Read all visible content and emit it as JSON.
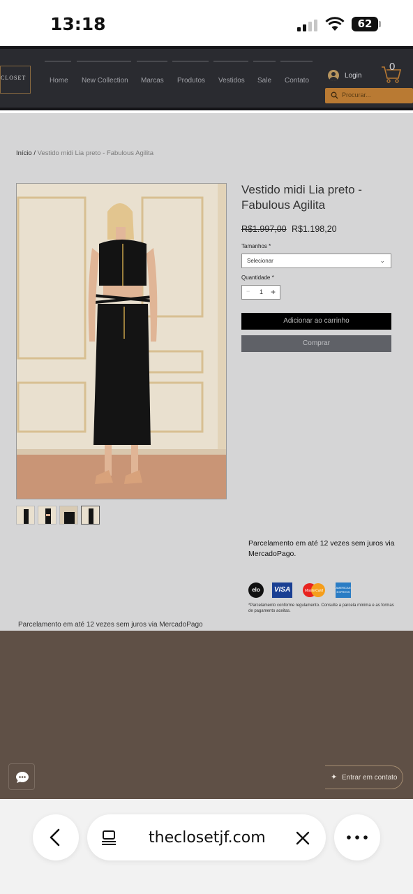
{
  "status_bar": {
    "time": "13:18",
    "battery": "62"
  },
  "header": {
    "logo_text": "CLOSET",
    "nav": [
      "Home",
      "New Collection",
      "Marcas",
      "Produtos",
      "Vestidos",
      "Sale",
      "Contato"
    ],
    "login_label": "Login",
    "cart_count": "0",
    "search_placeholder": "Procurar..."
  },
  "breadcrumb": {
    "home": "Início",
    "separator": " / ",
    "current": "Vestido midi Lia preto - Fabulous Agilita"
  },
  "product": {
    "title": "Vestido midi Lia preto - Fabulous Agilita",
    "old_price": "R$1.997,00",
    "new_price": "R$1.198,20",
    "size_label": "Tamanhos *",
    "size_placeholder": "Selecionar",
    "qty_label": "Quantidade *",
    "qty_value": "1",
    "qty_minus": "−",
    "qty_plus": "+",
    "add_to_cart": "Adicionar ao carrinho",
    "buy": "Comprar"
  },
  "payment": {
    "installments": "Parcelamento em até 12 vezes sem juros via MercadoPago.",
    "logos": {
      "elo": "elo",
      "visa": "VISA",
      "mastercard": "MasterCard",
      "amex": "AMERICAN EXPRESS"
    },
    "note": "*Parcelamento conforme regulamento. Consulte a parcela mínima e as formas de pagamento aceitas.",
    "bottom_text": "Parcelamento em até 12 vezes sem juros via MercadoPago"
  },
  "chat": {
    "contact_label": "Entrar em contato"
  },
  "browser": {
    "url": "theclosetjf.com"
  },
  "colors": {
    "header_bg": "#2a2b30",
    "accent": "#b97a33",
    "page_bg": "#d5d5d6",
    "footer_bg": "#5f5046"
  }
}
